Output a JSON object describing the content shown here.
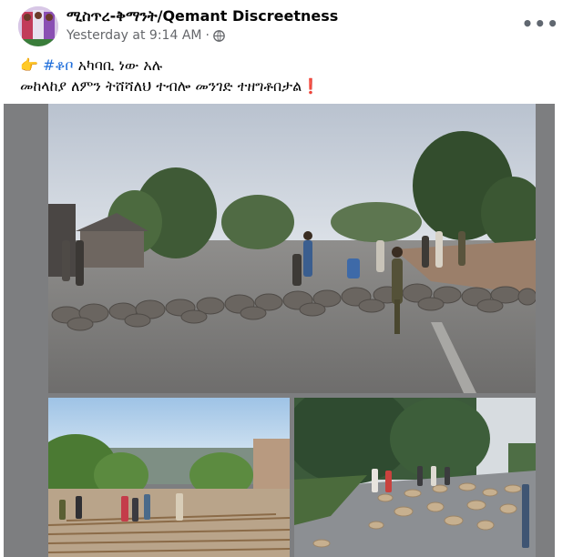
{
  "post": {
    "author": "ሚስጥረ-ቅማንት/Qemant Discreetness",
    "timestamp": "Yesterday at 9:14 AM",
    "separator": "·",
    "privacy_icon": "globe-icon",
    "more_icon": "more-options-icon",
    "caption": {
      "line1_emoji": "👉",
      "hashtag": "#ቆቦ",
      "line1_text": " አካባቢ ነው አሉ",
      "line2_text": "መከላከያ ለምን ትሸሻለህ ተብሎ መንገድ ተዘግቶበታል",
      "line2_emoji": "❗"
    }
  },
  "colors": {
    "hashtag": "#216fdb",
    "media_background": "#7d7e80"
  }
}
